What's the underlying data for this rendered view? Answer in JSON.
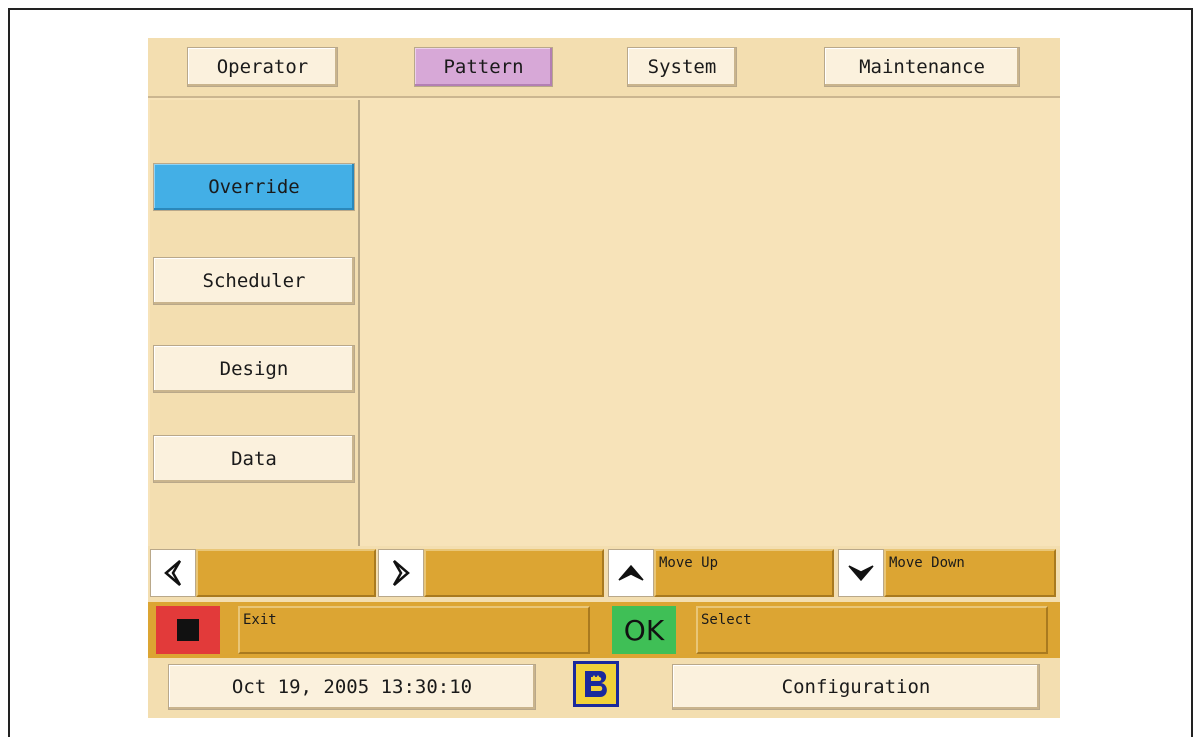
{
  "tabs": {
    "operator": "Operator",
    "pattern": "Pattern",
    "system": "System",
    "maintenance": "Maintenance"
  },
  "sidebar": {
    "items": [
      {
        "label": "Override",
        "active": true
      },
      {
        "label": "Scheduler",
        "active": false
      },
      {
        "label": "Design",
        "active": false
      },
      {
        "label": "Data",
        "active": false
      }
    ]
  },
  "nav": {
    "left_field": "",
    "right_field": "",
    "move_up": "Move Up",
    "move_down": "Move Down"
  },
  "actions": {
    "exit": "Exit",
    "ok_icon": "OK",
    "select": "Select"
  },
  "status": {
    "datetime": "Oct 19, 2005 13:30:10",
    "configuration": "Configuration"
  },
  "colors": {
    "background": "#f7e3b9",
    "active_tab": "#d7a8d7",
    "active_side": "#43afe6",
    "field": "#dca533",
    "exit": "#e23a3a",
    "ok": "#3fbf56",
    "logo_fill": "#f2d23a",
    "logo_border": "#1b2a9c"
  },
  "icons": {
    "left": "arrow-left-icon",
    "right": "arrow-right-icon",
    "up": "arrow-up-icon",
    "down": "arrow-down-icon",
    "exit": "stop-icon",
    "ok": "ok-icon",
    "logo": "brand-logo-icon"
  }
}
